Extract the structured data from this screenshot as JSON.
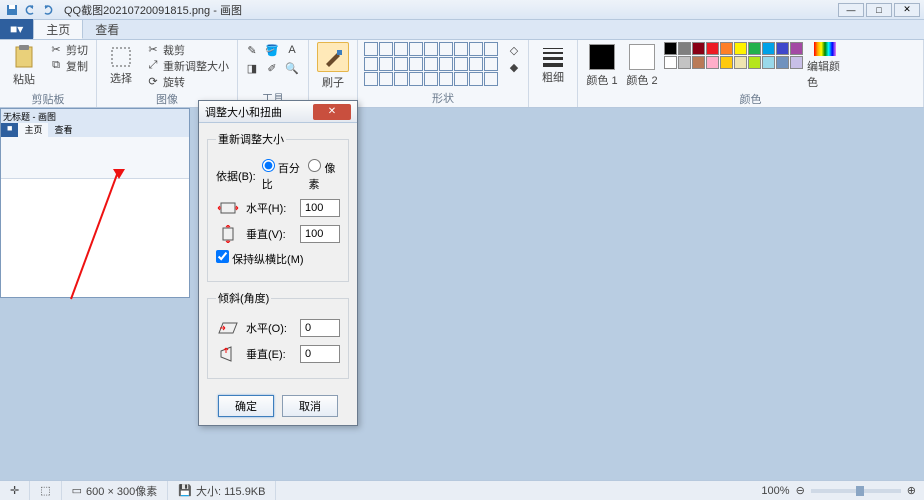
{
  "titlebar": {
    "doc_title": "QQ截图20210720091815.png - 画图"
  },
  "win_controls": {
    "min": "—",
    "max": "□",
    "close": "✕"
  },
  "tabs": {
    "file": "■▾",
    "home": "主页",
    "view": "查看"
  },
  "ribbon": {
    "clipboard": {
      "paste": "粘贴",
      "cut": "剪切",
      "copy": "复制",
      "label": "剪贴板"
    },
    "image": {
      "select": "选择",
      "crop": "裁剪",
      "resize": "重新调整大小",
      "rotate": "旋转",
      "label": "图像"
    },
    "tools": {
      "label": "工具"
    },
    "brush": {
      "label": "刷子"
    },
    "shapes": {
      "label": "形状"
    },
    "size": {
      "label": "粗细"
    },
    "colors": {
      "color1": "颜色 1",
      "color2": "颜色 2",
      "edit": "编辑颜色",
      "label": "颜色"
    }
  },
  "embedded": {
    "title": "无标题 - 画图"
  },
  "dialog": {
    "title": "调整大小和扭曲",
    "resize_legend": "重新调整大小",
    "basis_label": "依据(B):",
    "opt_percent": "百分比",
    "opt_pixels": "像素",
    "h_label": "水平(H):",
    "v_label": "垂直(V):",
    "h_val": "100",
    "v_val": "100",
    "aspect": "保持纵横比(M)",
    "skew_legend": "倾斜(角度)",
    "skew_h_label": "水平(O):",
    "skew_v_label": "垂直(E):",
    "skew_h_val": "0",
    "skew_v_val": "0",
    "ok": "确定",
    "cancel": "取消"
  },
  "statusbar": {
    "dims": "600 × 300像素",
    "size": "大小: 115.9KB",
    "zoom": "100%"
  },
  "palette": [
    "#000",
    "#7f7f7f",
    "#880015",
    "#ed1c24",
    "#ff7f27",
    "#fff200",
    "#22b14c",
    "#00a2e8",
    "#3f48cc",
    "#a349a4",
    "#fff",
    "#c3c3c3",
    "#b97a57",
    "#ffaec9",
    "#ffc90e",
    "#efe4b0",
    "#b5e61d",
    "#99d9ea",
    "#7092be",
    "#c8bfe7"
  ]
}
